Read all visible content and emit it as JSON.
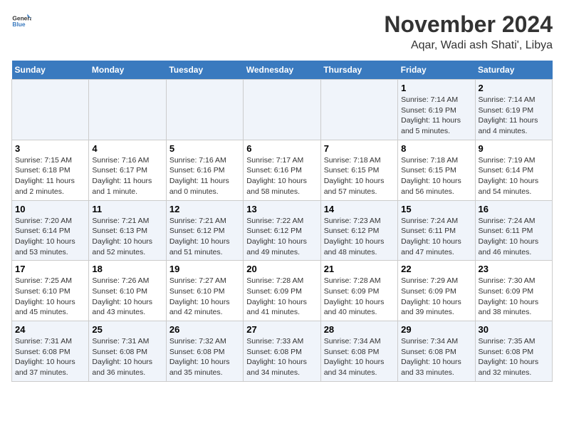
{
  "logo": {
    "general": "General",
    "blue": "Blue"
  },
  "title": "November 2024",
  "subtitle": "Aqar, Wadi ash Shati', Libya",
  "weekdays": [
    "Sunday",
    "Monday",
    "Tuesday",
    "Wednesday",
    "Thursday",
    "Friday",
    "Saturday"
  ],
  "weeks": [
    [
      {
        "day": "",
        "info": ""
      },
      {
        "day": "",
        "info": ""
      },
      {
        "day": "",
        "info": ""
      },
      {
        "day": "",
        "info": ""
      },
      {
        "day": "",
        "info": ""
      },
      {
        "day": "1",
        "info": "Sunrise: 7:14 AM\nSunset: 6:19 PM\nDaylight: 11 hours and 5 minutes."
      },
      {
        "day": "2",
        "info": "Sunrise: 7:14 AM\nSunset: 6:19 PM\nDaylight: 11 hours and 4 minutes."
      }
    ],
    [
      {
        "day": "3",
        "info": "Sunrise: 7:15 AM\nSunset: 6:18 PM\nDaylight: 11 hours and 2 minutes."
      },
      {
        "day": "4",
        "info": "Sunrise: 7:16 AM\nSunset: 6:17 PM\nDaylight: 11 hours and 1 minute."
      },
      {
        "day": "5",
        "info": "Sunrise: 7:16 AM\nSunset: 6:16 PM\nDaylight: 11 hours and 0 minutes."
      },
      {
        "day": "6",
        "info": "Sunrise: 7:17 AM\nSunset: 6:16 PM\nDaylight: 10 hours and 58 minutes."
      },
      {
        "day": "7",
        "info": "Sunrise: 7:18 AM\nSunset: 6:15 PM\nDaylight: 10 hours and 57 minutes."
      },
      {
        "day": "8",
        "info": "Sunrise: 7:18 AM\nSunset: 6:15 PM\nDaylight: 10 hours and 56 minutes."
      },
      {
        "day": "9",
        "info": "Sunrise: 7:19 AM\nSunset: 6:14 PM\nDaylight: 10 hours and 54 minutes."
      }
    ],
    [
      {
        "day": "10",
        "info": "Sunrise: 7:20 AM\nSunset: 6:14 PM\nDaylight: 10 hours and 53 minutes."
      },
      {
        "day": "11",
        "info": "Sunrise: 7:21 AM\nSunset: 6:13 PM\nDaylight: 10 hours and 52 minutes."
      },
      {
        "day": "12",
        "info": "Sunrise: 7:21 AM\nSunset: 6:12 PM\nDaylight: 10 hours and 51 minutes."
      },
      {
        "day": "13",
        "info": "Sunrise: 7:22 AM\nSunset: 6:12 PM\nDaylight: 10 hours and 49 minutes."
      },
      {
        "day": "14",
        "info": "Sunrise: 7:23 AM\nSunset: 6:12 PM\nDaylight: 10 hours and 48 minutes."
      },
      {
        "day": "15",
        "info": "Sunrise: 7:24 AM\nSunset: 6:11 PM\nDaylight: 10 hours and 47 minutes."
      },
      {
        "day": "16",
        "info": "Sunrise: 7:24 AM\nSunset: 6:11 PM\nDaylight: 10 hours and 46 minutes."
      }
    ],
    [
      {
        "day": "17",
        "info": "Sunrise: 7:25 AM\nSunset: 6:10 PM\nDaylight: 10 hours and 45 minutes."
      },
      {
        "day": "18",
        "info": "Sunrise: 7:26 AM\nSunset: 6:10 PM\nDaylight: 10 hours and 43 minutes."
      },
      {
        "day": "19",
        "info": "Sunrise: 7:27 AM\nSunset: 6:10 PM\nDaylight: 10 hours and 42 minutes."
      },
      {
        "day": "20",
        "info": "Sunrise: 7:28 AM\nSunset: 6:09 PM\nDaylight: 10 hours and 41 minutes."
      },
      {
        "day": "21",
        "info": "Sunrise: 7:28 AM\nSunset: 6:09 PM\nDaylight: 10 hours and 40 minutes."
      },
      {
        "day": "22",
        "info": "Sunrise: 7:29 AM\nSunset: 6:09 PM\nDaylight: 10 hours and 39 minutes."
      },
      {
        "day": "23",
        "info": "Sunrise: 7:30 AM\nSunset: 6:09 PM\nDaylight: 10 hours and 38 minutes."
      }
    ],
    [
      {
        "day": "24",
        "info": "Sunrise: 7:31 AM\nSunset: 6:08 PM\nDaylight: 10 hours and 37 minutes."
      },
      {
        "day": "25",
        "info": "Sunrise: 7:31 AM\nSunset: 6:08 PM\nDaylight: 10 hours and 36 minutes."
      },
      {
        "day": "26",
        "info": "Sunrise: 7:32 AM\nSunset: 6:08 PM\nDaylight: 10 hours and 35 minutes."
      },
      {
        "day": "27",
        "info": "Sunrise: 7:33 AM\nSunset: 6:08 PM\nDaylight: 10 hours and 34 minutes."
      },
      {
        "day": "28",
        "info": "Sunrise: 7:34 AM\nSunset: 6:08 PM\nDaylight: 10 hours and 34 minutes."
      },
      {
        "day": "29",
        "info": "Sunrise: 7:34 AM\nSunset: 6:08 PM\nDaylight: 10 hours and 33 minutes."
      },
      {
        "day": "30",
        "info": "Sunrise: 7:35 AM\nSunset: 6:08 PM\nDaylight: 10 hours and 32 minutes."
      }
    ]
  ]
}
